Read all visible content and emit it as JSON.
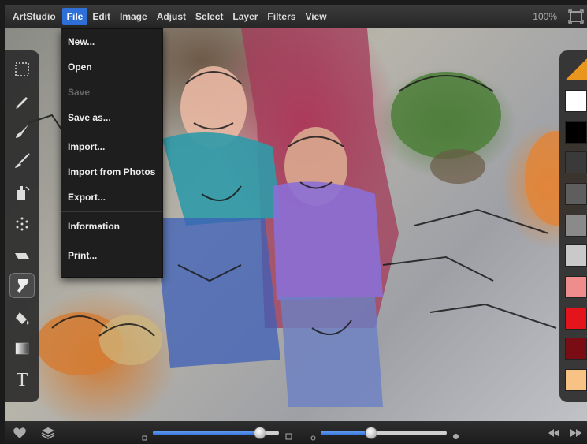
{
  "menubar": {
    "app_name": "ArtStudio",
    "menus": [
      "File",
      "Edit",
      "Image",
      "Adjust",
      "Select",
      "Layer",
      "Filters",
      "View"
    ],
    "active_menu": "File",
    "zoom": "100%",
    "fullscreen_icon": "fullscreen-icon"
  },
  "file_menu": {
    "items": [
      {
        "label": "New...",
        "enabled": true
      },
      {
        "label": "Open",
        "enabled": true
      },
      {
        "label": "Save",
        "enabled": false
      },
      {
        "label": "Save as...",
        "enabled": true
      },
      {
        "label": "Import...",
        "enabled": true
      },
      {
        "label": "Import from Photos",
        "enabled": true
      },
      {
        "label": "Export...",
        "enabled": true
      },
      {
        "label": "Information",
        "enabled": true
      },
      {
        "label": "Print...",
        "enabled": true
      }
    ]
  },
  "toolbar": {
    "tools": [
      "selection-icon",
      "pencil-icon",
      "brush-icon",
      "fine-brush-icon",
      "stamp-icon",
      "spray-icon",
      "eraser-icon",
      "smudge-icon",
      "fill-bucket-icon",
      "gradient-icon",
      "text-icon"
    ],
    "selected_tool": "smudge-icon",
    "text_tool_glyph": "T"
  },
  "palette": {
    "colors": [
      "#e8961e",
      "#ffffff",
      "#000000",
      "#3a3a3a",
      "#5e5e5e",
      "#8a8a8a",
      "#c9c9c9",
      "#ef8c8c",
      "#e3141b",
      "#7a0d13",
      "#f7c283"
    ]
  },
  "bottombar": {
    "brush_size": 0.85,
    "opacity": 0.4,
    "icons": [
      "heart-icon",
      "layers-icon",
      "rewind-icon",
      "fast-forward-icon"
    ]
  },
  "colors": {
    "accent": "#2f6fd8",
    "menubar_bg": "#2b2b2b",
    "panel_bg": "#1e1e1e"
  }
}
